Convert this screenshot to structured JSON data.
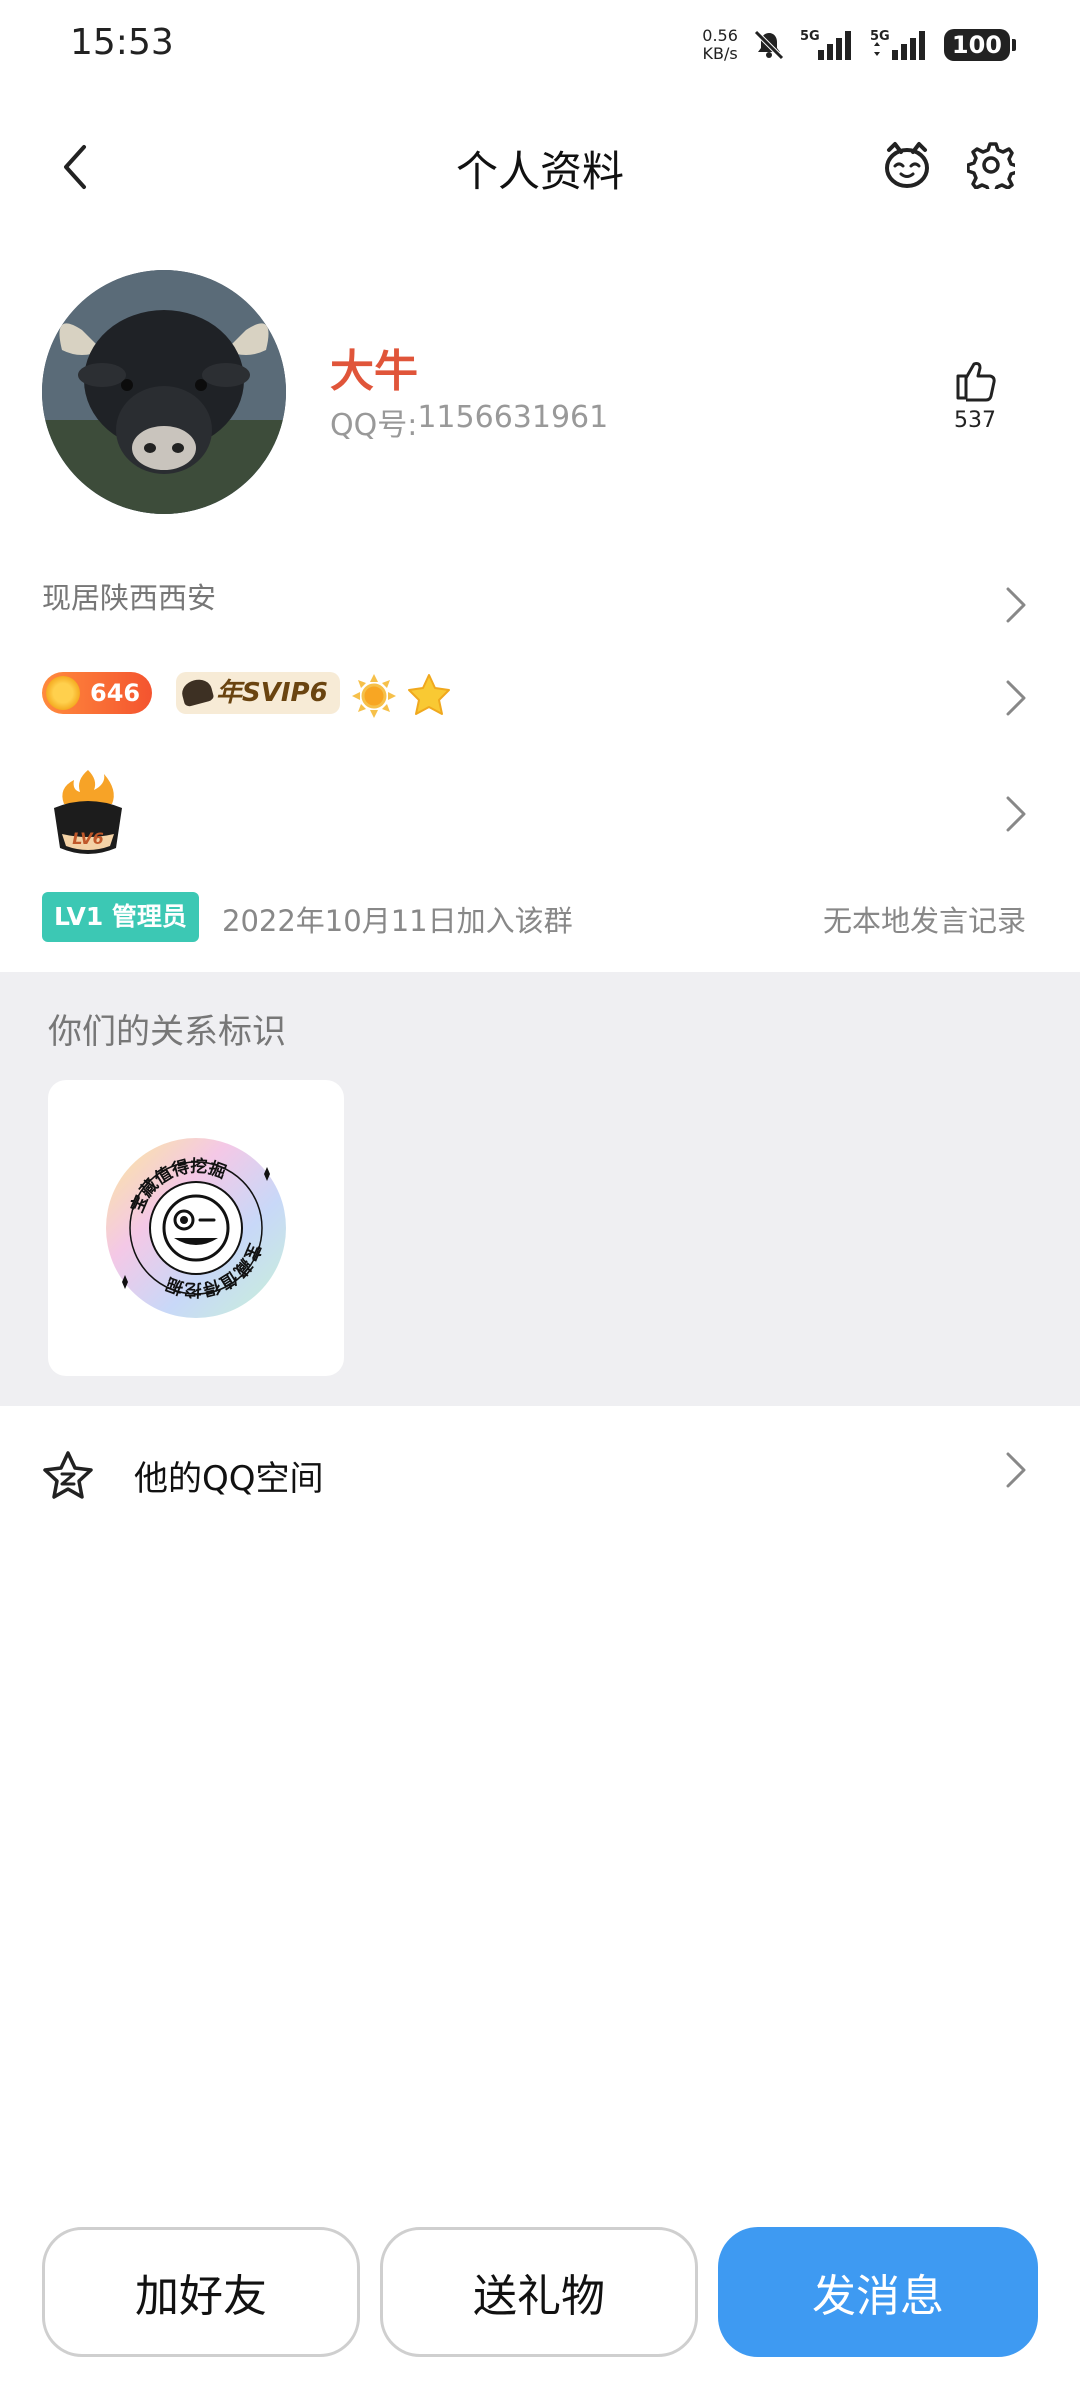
{
  "status_bar": {
    "time": "15:53",
    "net_speed_value": "0.56",
    "net_speed_unit": "KB/s",
    "network_1": "5G",
    "network_2": "5G",
    "battery": "100"
  },
  "header": {
    "title": "个人资料"
  },
  "profile": {
    "nickname": "大牛",
    "qq_label": "QQ号: ",
    "qq_number": "1156631961",
    "likes": "537",
    "location": "现居陕西西安"
  },
  "badges": {
    "level_value": "646",
    "svip_label": "年SVIP6",
    "lv_label": "LV6"
  },
  "group": {
    "member_badge": "LV1 管理员",
    "join_text": "2022年10月11日加入该群",
    "speak_record": "无本地发言记录"
  },
  "relation": {
    "title": "你们的关系标识",
    "badge_text": "宝藏值得挖掘"
  },
  "qzone": {
    "label": "他的QQ空间"
  },
  "actions": {
    "add_friend": "加好友",
    "send_gift": "送礼物",
    "send_message": "发消息"
  },
  "colors": {
    "nickname": "#e0553a",
    "primary_button": "#3e9af2",
    "admin_badge": "#3cc8b4",
    "section_bg": "#efeff2"
  }
}
